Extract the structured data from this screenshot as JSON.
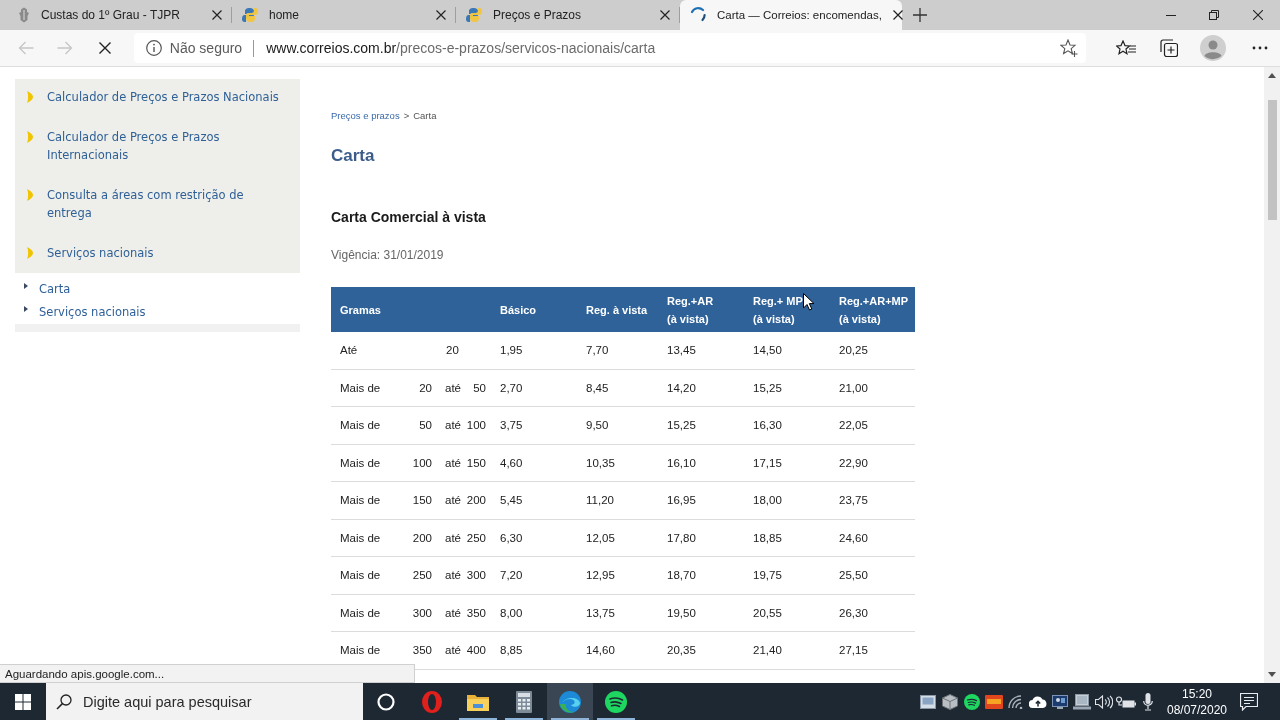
{
  "browser": {
    "tabs": [
      {
        "title": "Custas do 1º Grau - TJPR",
        "kind": "crest",
        "selected": false
      },
      {
        "title": "home",
        "kind": "logo",
        "selected": false
      },
      {
        "title": "Preços e Prazos",
        "kind": "logo",
        "selected": false
      },
      {
        "title": "Carta — Correios: encomendas,",
        "kind": "spinner",
        "selected": true
      }
    ],
    "nav": [
      {
        "kind": "back",
        "disabled": true
      },
      {
        "kind": "forward",
        "disabled": true
      }
    ],
    "loading": true,
    "address": {
      "security": "Não seguro",
      "host": "www.correios.com.br",
      "path": "/precos-e-prazos/servicos-nacionais/carta"
    },
    "status": "Aguardando apis.google.com..."
  },
  "sidebar": {
    "items": [
      "Calculador de Preços e Prazos Nacionais",
      "Calculador de Preços e Prazos Internacionais",
      "Consulta a áreas com restrição de entrega",
      "Serviços nacionais"
    ],
    "subitems": [
      "Carta",
      "Serviços nacionais"
    ]
  },
  "breadcrumb": {
    "link": "Preços e prazos",
    "separator": ">",
    "current": "Carta"
  },
  "title": "Carta",
  "section": "Carta Comercial à vista",
  "validity": "Vigência: 31/01/2019",
  "table": {
    "columns": [
      "Gramas",
      "Básico",
      "Reg. à vista",
      "Reg.+AR\n(à vista)",
      "Reg.+ MP\n(à vista)",
      "Reg.+AR+MP\n(à vista)"
    ],
    "rows": [
      {
        "kind": "up_to",
        "label": "Até",
        "limit": "20",
        "prices": [
          "1,95",
          "7,70",
          "13,45",
          "14,50",
          "20,25"
        ]
      },
      {
        "kind": "range",
        "label": "Mais de",
        "from": "20",
        "until": "até",
        "to": "50",
        "prices": [
          "2,70",
          "8,45",
          "14,20",
          "15,25",
          "21,00"
        ]
      },
      {
        "kind": "range",
        "label": "Mais de",
        "from": "50",
        "until": "até",
        "to": "100",
        "prices": [
          "3,75",
          "9,50",
          "15,25",
          "16,30",
          "22,05"
        ]
      },
      {
        "kind": "range",
        "label": "Mais de",
        "from": "100",
        "until": "até",
        "to": "150",
        "prices": [
          "4,60",
          "10,35",
          "16,10",
          "17,15",
          "22,90"
        ]
      },
      {
        "kind": "range",
        "label": "Mais de",
        "from": "150",
        "until": "até",
        "to": "200",
        "prices": [
          "5,45",
          "11,20",
          "16,95",
          "18,00",
          "23,75"
        ]
      },
      {
        "kind": "range",
        "label": "Mais de",
        "from": "200",
        "until": "até",
        "to": "250",
        "prices": [
          "6,30",
          "12,05",
          "17,80",
          "18,85",
          "24,60"
        ]
      },
      {
        "kind": "range",
        "label": "Mais de",
        "from": "250",
        "until": "até",
        "to": "300",
        "prices": [
          "7,20",
          "12,95",
          "18,70",
          "19,75",
          "25,50"
        ]
      },
      {
        "kind": "range",
        "label": "Mais de",
        "from": "300",
        "until": "até",
        "to": "350",
        "prices": [
          "8,00",
          "13,75",
          "19,50",
          "20,55",
          "26,30"
        ]
      },
      {
        "kind": "range",
        "label": "Mais de",
        "from": "350",
        "until": "até",
        "to": "400",
        "prices": [
          "8,85",
          "14,60",
          "20,35",
          "21,40",
          "27,15"
        ]
      }
    ]
  },
  "taskbar": {
    "search": {
      "placeholder": "Digite aqui para pesquisar"
    },
    "apps": [
      {
        "kind": "cortana",
        "selected": false,
        "running": false
      },
      {
        "kind": "opera",
        "selected": false,
        "running": false
      },
      {
        "kind": "explorer",
        "selected": false,
        "running": true
      },
      {
        "kind": "calculator",
        "selected": false,
        "running": true
      },
      {
        "kind": "edge",
        "selected": true,
        "running": true
      },
      {
        "kind": "spotify",
        "selected": false,
        "running": true
      }
    ],
    "tray": [
      {
        "kind": "display"
      },
      {
        "kind": "package"
      },
      {
        "kind": "spotify"
      },
      {
        "kind": "badge"
      },
      {
        "kind": "wifi"
      },
      {
        "kind": "cloud"
      },
      {
        "kind": "monitor"
      },
      {
        "kind": "laptop"
      },
      {
        "kind": "volume"
      },
      {
        "kind": "power"
      },
      {
        "kind": "microphone"
      }
    ],
    "time": "15:20",
    "date": "08/07/2020"
  }
}
